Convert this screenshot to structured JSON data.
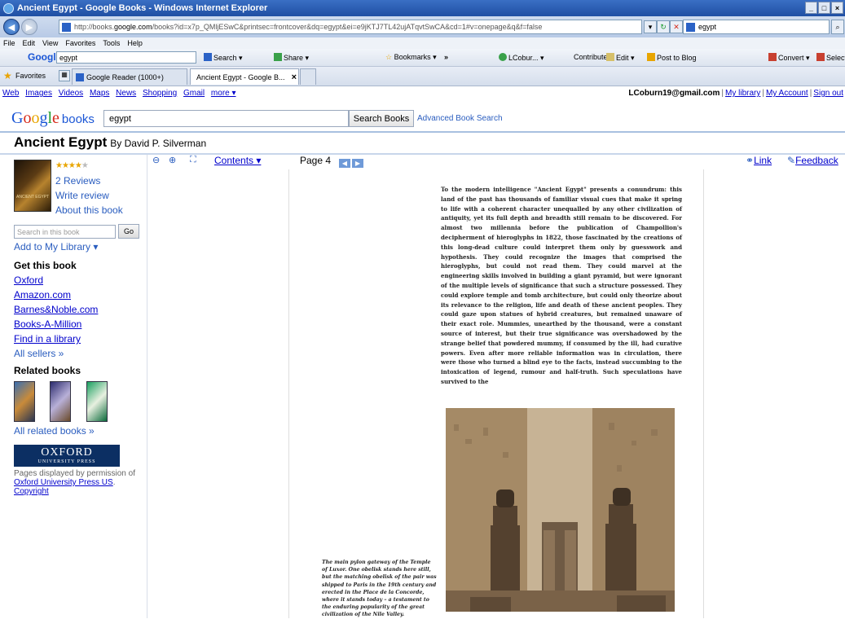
{
  "window": {
    "title": "Ancient Egypt - Google Books - Windows Internet Explorer"
  },
  "address": {
    "url_prefix": "http://books.",
    "url_domain": "google.com",
    "url_suffix": "/books?id=x7p_QMljESwC&printsec=frontcover&dq=egypt&ei=e9jKTJ7TL42ujATqvtSwCA&cd=1#v=onepage&q&f=false",
    "search_value": "egypt"
  },
  "menu": [
    "File",
    "Edit",
    "View",
    "Favorites",
    "Tools",
    "Help"
  ],
  "google_toolbar": {
    "logo": "Google",
    "query": "egypt",
    "search_label": "Search",
    "share_label": "Share",
    "bookmarks_label": "Bookmarks",
    "more": "»",
    "lcoburn_label": "LCobur...",
    "contribute": "Contribute",
    "edit": "Edit",
    "post_to_blog": "Post to Blog",
    "convert": "Convert",
    "select": "Select"
  },
  "favorites_bar": {
    "favorites_label": "Favorites",
    "tabs": [
      {
        "label": "Google Reader (1000+)",
        "active": false
      },
      {
        "label": "Ancient Egypt - Google B...",
        "active": true
      }
    ]
  },
  "top_links": [
    "Web",
    "Images",
    "Videos",
    "Maps",
    "News",
    "Shopping",
    "Gmail",
    "more ▾"
  ],
  "account": {
    "email": "LCoburn19@gmail.com",
    "my_library": "My library",
    "my_account": "My Account",
    "sign_out": "Sign out"
  },
  "search": {
    "books_label": "books",
    "query": "egypt",
    "button": "Search Books",
    "advanced": "Advanced Book Search"
  },
  "book": {
    "title": "Ancient Egypt",
    "byline": "By David P. Silverman",
    "rating_stars": 4,
    "reviews": "2 Reviews",
    "write_review": "Write review",
    "about": "About this book",
    "search_placeholder": "Search in this book",
    "go": "Go",
    "add_library": "Add to My Library ▾"
  },
  "get_this_book": {
    "heading": "Get this book",
    "sellers": [
      "Oxford",
      "Amazon.com",
      "Barnes&Noble.com",
      "Books-A-Million",
      "Find in a library"
    ],
    "all_sellers": "All sellers »"
  },
  "related": {
    "heading": "Related books",
    "all": "All related books »"
  },
  "publisher": {
    "name": "OXFORD",
    "sub": "UNIVERSITY PRESS",
    "perm_text": "Pages displayed by permission of",
    "perm_link": "Oxford University Press US",
    "copyright": "Copyright"
  },
  "viewer": {
    "contents": "Contents ▾",
    "page": "Page 4",
    "link": "Link",
    "feedback": "Feedback"
  },
  "page_text": "To the modern intelligence \"Ancient Egypt\" presents a conundrum: this land of the past has thousands of familiar visual cues that make it spring to life with a coherent character unequalled by any other civilization of antiquity, yet its full depth and breadth still remain to be discovered. For almost two millennia before the publication of Champollion's decipherment of hieroglyphs in 1822, those fascinated by the creations of this long-dead culture could interpret them only by guesswork and hypothesis. They could recognize the images that comprised the hieroglyphs, but could not read them. They could marvel at the engineering skills involved in building a giant pyramid, but were ignorant of the multiple levels of significance that such a structure possessed. They could explore temple and tomb architecture, but could only theorize about its relevance to the religion, life and death of these ancient peoples. They could gaze upon statues of hybrid creatures, but remained unaware of their exact role. Mummies, unearthed by the thousand, were a constant source of interest, but their true significance was overshadowed by the strange belief that powdered mummy, if consumed by the ill, had curative powers. Even after more reliable information was in circulation, there were those who turned a blind eye to the facts, instead succumbing to the intoxication of legend, rumour and half-truth. Such speculations have survived to the",
  "caption": "The main pylon gateway of the Temple of Luxor. One obelisk stands here still, but the matching obelisk of the pair was shipped to Paris in the 19th century and erected in the Place de la Concorde, where it stands today – a testament to the enduring popularity of the great civilization of the Nile Valley."
}
